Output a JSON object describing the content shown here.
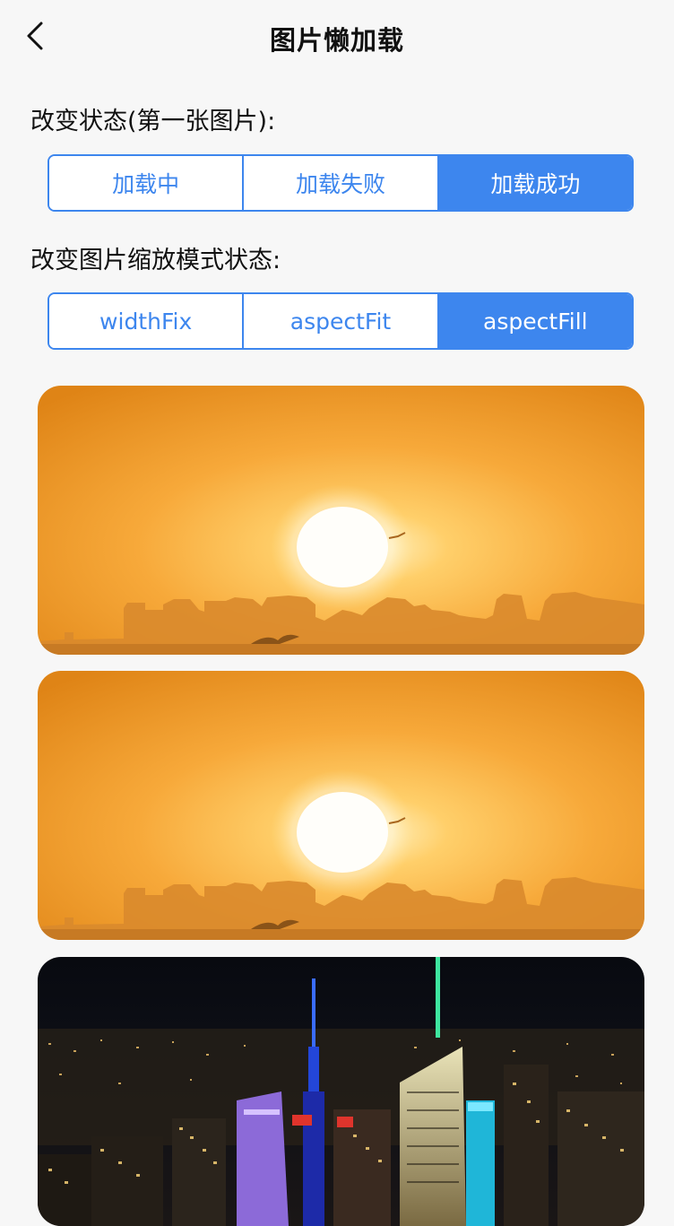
{
  "nav": {
    "title": "图片懒加载",
    "back_icon": "chevron-left-icon"
  },
  "status_section": {
    "label": "改变状态(第一张图片):",
    "options": [
      "加载中",
      "加载失败",
      "加载成功"
    ],
    "selected": "加载成功"
  },
  "mode_section": {
    "label": "改变图片缩放模式状态:",
    "options": [
      "widthFix",
      "aspectFit",
      "aspectFill"
    ],
    "selected": "aspectFill"
  },
  "images": [
    {
      "subject": "sunset-over-city-skyline"
    },
    {
      "subject": "sunset-over-city-skyline"
    },
    {
      "subject": "night-city-aerial-view"
    }
  ],
  "colors": {
    "accent": "#3d86ee",
    "background": "#f7f7f7",
    "text": "#111111"
  }
}
